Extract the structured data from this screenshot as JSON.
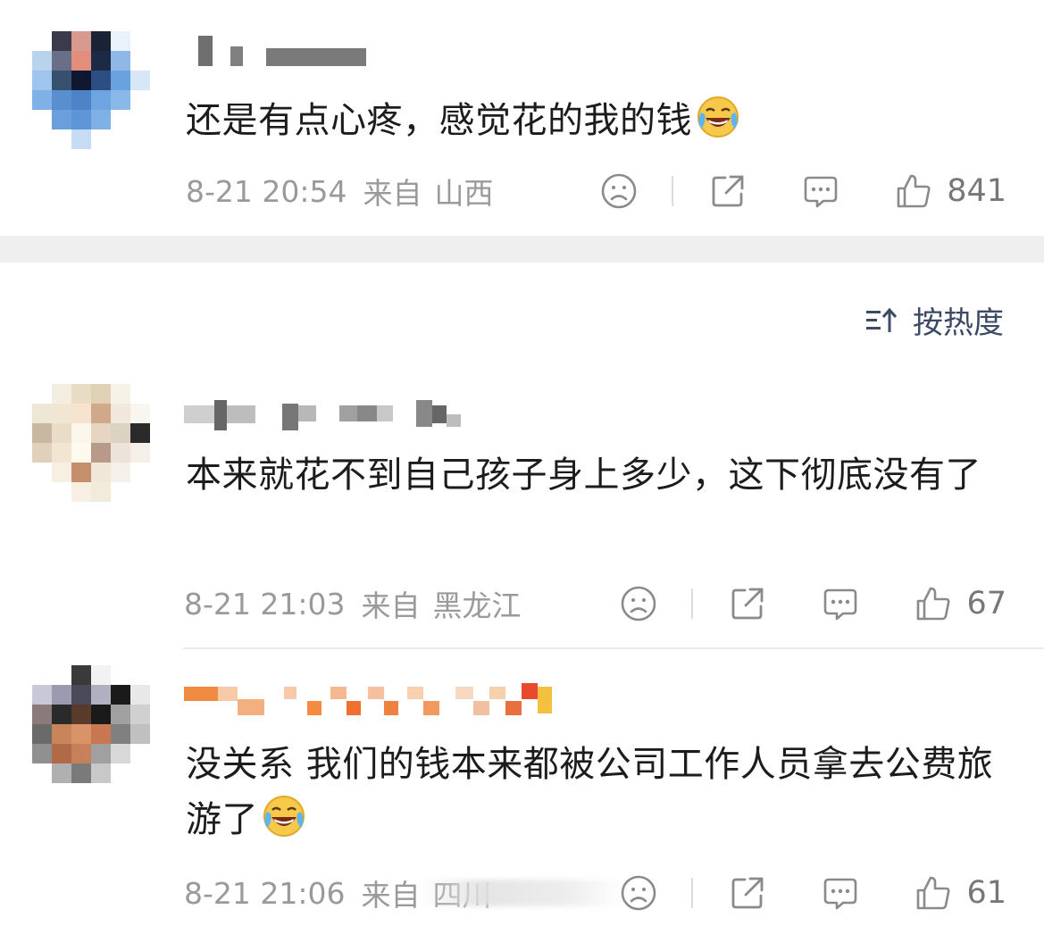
{
  "comments": [
    {
      "text": "还是有点心疼，感觉花的我的钱",
      "emoji": "laughing-tears-emoji",
      "time": "8-21 20:54",
      "from_label": "来自",
      "location": "山西",
      "likes": "841"
    },
    {
      "text": "本来就花不到自己孩子身上多少，这下彻底没有了",
      "time": "8-21 21:03",
      "from_label": "来自",
      "location": "黑龙江",
      "likes": "67"
    },
    {
      "text": "没关系 我们的钱本来都被公司工作人员拿去公费旅游了",
      "emoji": "laughing-tears-emoji",
      "time": "8-21 21:06",
      "from_label": "来自",
      "location": "四川",
      "likes": "61"
    }
  ],
  "sort": {
    "label": "按热度"
  },
  "colors": {
    "meta_text": "#9a9a9a",
    "sort_text": "#3d4a66",
    "band": "#efefef"
  }
}
